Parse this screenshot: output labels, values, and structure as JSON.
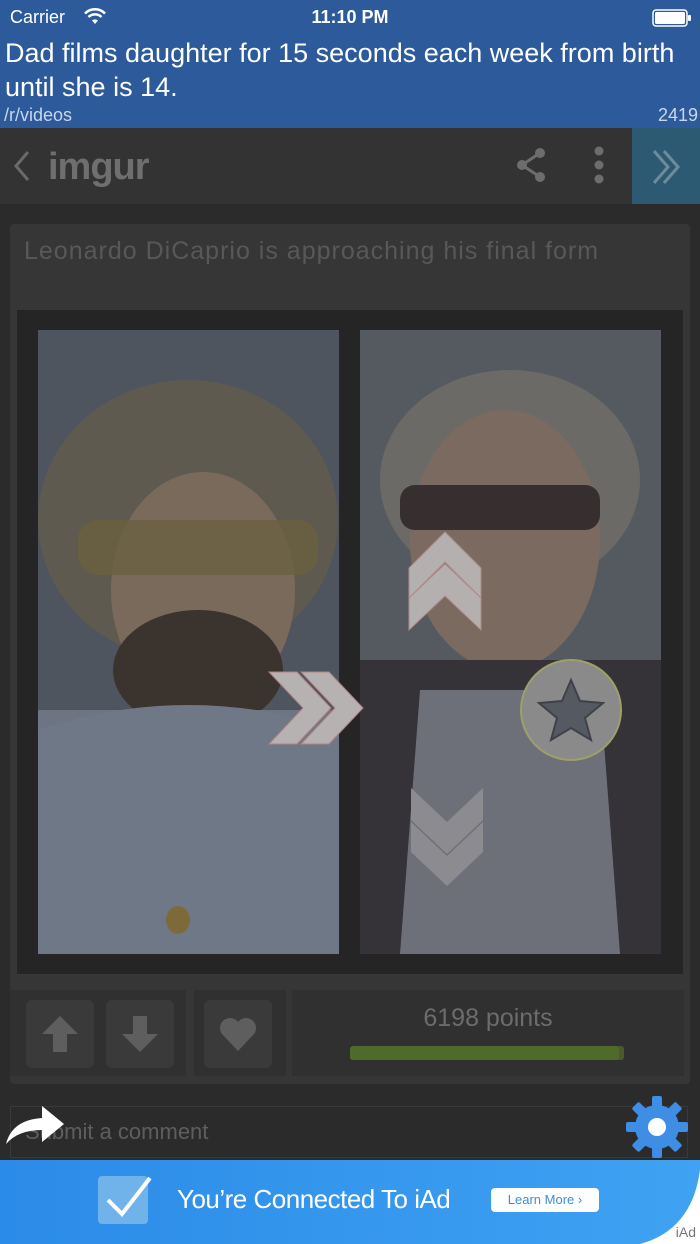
{
  "status_bar": {
    "carrier": "Carrier",
    "time": "11:10 PM"
  },
  "reddit_post": {
    "title": "Dad films daughter for 15 seconds each week from birth until she is 14.",
    "subreddit": "/r/videos",
    "score": "2419"
  },
  "imgur_nav": {
    "logo": "imgur"
  },
  "image_post": {
    "title": "Leonardo DiCaprio is approaching his final form",
    "points": "6198 points"
  },
  "comment": {
    "placeholder": "Submit a comment"
  },
  "ad": {
    "text": "You’re Connected To iAd",
    "button": "Learn More",
    "badge": "iAd"
  },
  "colors": {
    "header_blue": "#2d5a9b",
    "accent_teal": "#2d5a73",
    "ad_blue": "#2f8fe6"
  },
  "icons": [
    "wifi-icon",
    "battery-icon",
    "back-chevron-icon",
    "share-icon",
    "more-vertical-icon",
    "next-chevron-icon",
    "upvote-arrow-icon",
    "downvote-arrow-icon",
    "heart-icon",
    "star-icon",
    "gear-icon",
    "share-arrow-icon",
    "checkmark-icon"
  ]
}
